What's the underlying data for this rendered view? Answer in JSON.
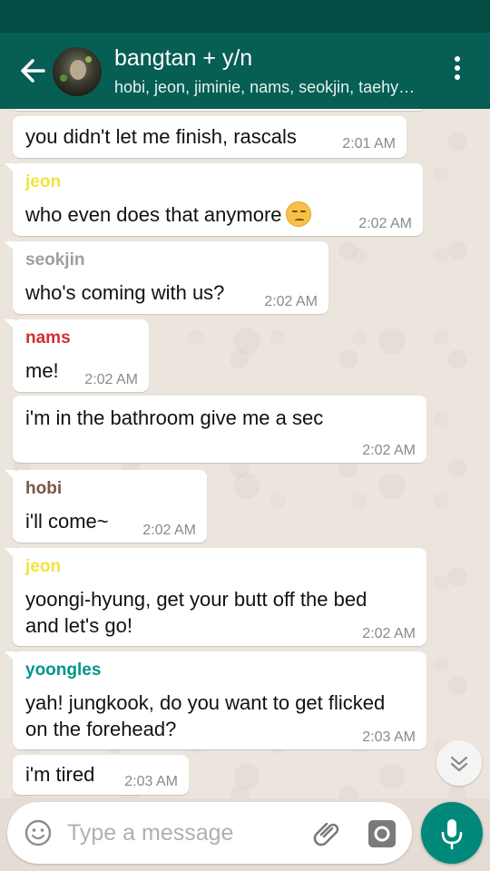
{
  "header": {
    "title": "bangtan + y/n",
    "subtitle": "hobi, jeon, jiminie, nams, seokjin, taehyung, yoongles",
    "accent": "#075e54"
  },
  "messages": [
    {
      "text": "you didn't let me finish, rascals",
      "time": "2:01 AM"
    },
    {
      "sender": "jeon",
      "sender_color": "#f3e43c",
      "text": "who even does that anymore",
      "emoji": "unamused-face-icon",
      "time": "2:02 AM"
    },
    {
      "sender": "seokjin",
      "sender_color": "#9e9e9e",
      "text": "who's coming with us?",
      "time": "2:02 AM"
    },
    {
      "sender": "nams",
      "sender_color": "#d32f2f",
      "text": "me!",
      "time": "2:02 AM"
    },
    {
      "text": "i'm in the bathroom give me a sec",
      "time": "2:02 AM"
    },
    {
      "sender": "hobi",
      "sender_color": "#795548",
      "text": "i'll come~",
      "time": "2:02 AM"
    },
    {
      "sender": "jeon",
      "sender_color": "#f3e43c",
      "text_lines": [
        "yoongi-hyung, get your butt off the bed",
        "and let's go!"
      ],
      "time": "2:02 AM"
    },
    {
      "sender": "yoongles",
      "sender_color": "#009688",
      "text_lines": [
        "yah! jungkook, do you want to get flicked",
        "on the forehead?"
      ],
      "time": "2:03 AM"
    },
    {
      "text": "i'm tired",
      "time": "2:03 AM"
    }
  ],
  "composer": {
    "placeholder": "Type a message"
  },
  "icons": {
    "back": "arrow-left-icon",
    "menu": "more-vertical-icon",
    "scroll": "chevron-double-down-icon",
    "emoji": "smiley-icon",
    "attach": "paperclip-icon",
    "camera": "camera-icon",
    "mic": "microphone-icon"
  }
}
